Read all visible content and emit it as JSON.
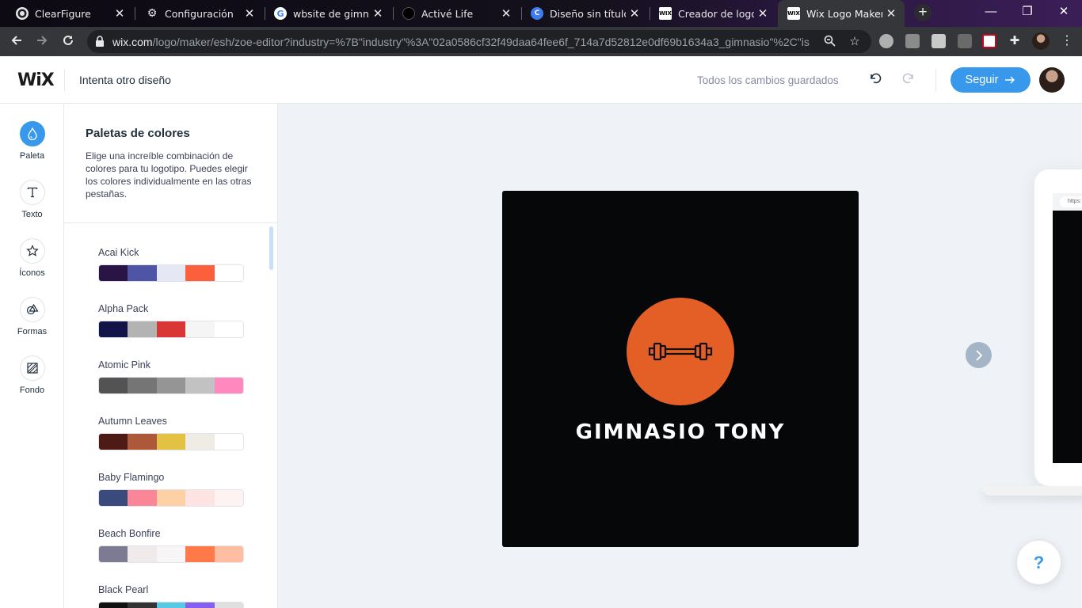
{
  "browser": {
    "tabs": [
      {
        "title": "ClearFigure",
        "icon": "github-icon",
        "active": false
      },
      {
        "title": "Configuración",
        "icon": "gear-icon",
        "active": false
      },
      {
        "title": "wbsite de gimnasio",
        "icon": "google-icon",
        "active": false
      },
      {
        "title": "Activé Life",
        "icon": "active-life-icon",
        "active": false
      },
      {
        "title": "Diseño sin título - ",
        "icon": "canva-icon",
        "active": false
      },
      {
        "title": "Creador de logos |",
        "icon": "wix-favicon",
        "active": false
      },
      {
        "title": "Wix Logo Maker",
        "icon": "wix-favicon",
        "active": true
      }
    ],
    "url_domain": "wix.com",
    "url_path": "/logo/maker/esh/zoe-editor?industry=%7B\"industry\"%3A\"02a0586cf32f49daa64fee6f_714a7d52812e0df69b1634a3_gimnasio\"%2C\"is..."
  },
  "header": {
    "logo": "WiX",
    "try_other": "Intenta otro diseño",
    "saved_status": "Todos los cambios guardados",
    "follow_button": "Seguir"
  },
  "rail": {
    "items": [
      {
        "label": "Paleta",
        "icon": "palette-drop-icon",
        "active": true
      },
      {
        "label": "Texto",
        "icon": "text-t-icon",
        "active": false
      },
      {
        "label": "Íconos",
        "icon": "star-icon",
        "active": false
      },
      {
        "label": "Formas",
        "icon": "shapes-icon",
        "active": false
      },
      {
        "label": "Fondo",
        "icon": "background-hatch-icon",
        "active": false
      }
    ]
  },
  "panel": {
    "title": "Paletas de colores",
    "description": "Elige una increíble combinación de colores para tu logotipo. Puedes elegir los colores individualmente en las otras pestañas.",
    "palettes": [
      {
        "name": "Acai Kick",
        "colors": [
          "#2a1445",
          "#4e55a6",
          "#e6e7f4",
          "#fb5f3b",
          "#ffffff"
        ]
      },
      {
        "name": "Alpha Pack",
        "colors": [
          "#111447",
          "#b3b3b3",
          "#d93636",
          "#f5f5f5",
          "#ffffff"
        ]
      },
      {
        "name": "Atomic Pink",
        "colors": [
          "#535353",
          "#757575",
          "#959595",
          "#c2c2c2",
          "#ff88bf"
        ]
      },
      {
        "name": "Autumn Leaves",
        "colors": [
          "#4e1a16",
          "#ad5838",
          "#e3c143",
          "#eeece4",
          "#ffffff"
        ]
      },
      {
        "name": "Baby Flamingo",
        "colors": [
          "#3a4a7c",
          "#fb8697",
          "#fed1a5",
          "#fde4e2",
          "#fff3f1"
        ]
      },
      {
        "name": "Beach Bonfire",
        "colors": [
          "#7d7b93",
          "#f0eaea",
          "#f7f5f5",
          "#ff7a48",
          "#ffbea1"
        ]
      },
      {
        "name": "Black Pearl",
        "colors": [
          "#111111",
          "#333333",
          "#58c9e4",
          "#8560f0",
          "#e0e0e0"
        ]
      }
    ]
  },
  "canvas": {
    "logo_text": "GIMNASIO TONY",
    "logo_icon": "dumbbell-icon",
    "logo_background": "#050708",
    "logo_circle_color": "#e45f26",
    "mockup_url": "https:",
    "help_label": "?"
  },
  "colors": {
    "accent": "#3899ec",
    "canvas_bg": "#eff2f6"
  }
}
